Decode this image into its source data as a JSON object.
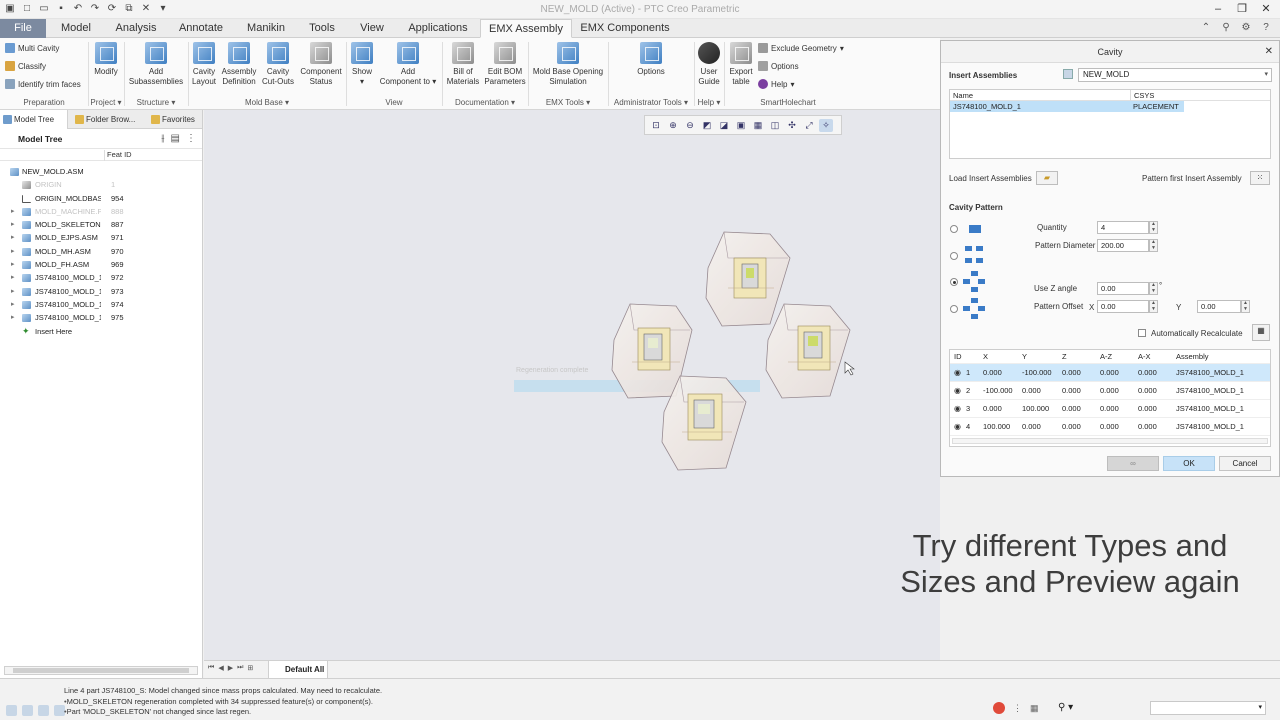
{
  "window": {
    "title": "NEW_MOLD (Active) - PTC Creo Parametric"
  },
  "tabs": [
    "File",
    "Model",
    "Analysis",
    "Annotate",
    "Manikin",
    "Tools",
    "View",
    "Applications",
    "EMX Assembly",
    "EMX Components"
  ],
  "active_tab": "EMX Assembly",
  "ribbon": {
    "prep_items": [
      "Multi Cavity",
      "Classify",
      "Identify trim faces"
    ],
    "modify": "Modify",
    "add_subassemblies": [
      "Add",
      "Subassemblies"
    ],
    "cavity_layout": [
      "Cavity",
      "Layout"
    ],
    "assembly_definition": [
      "Assembly",
      "Definition"
    ],
    "cavity_cutouts": [
      "Cavity",
      "Cut-Outs"
    ],
    "component_status": [
      "Component",
      "Status"
    ],
    "show": "Show",
    "add_component": [
      "Add",
      "Component to"
    ],
    "bill_of_materials": [
      "Bill of",
      "Materials"
    ],
    "edit_bom": [
      "Edit BOM",
      "Parameters"
    ],
    "mold_base_sim": [
      "Mold Base Opening",
      "Simulation"
    ],
    "options_big": "Options",
    "user_guide": [
      "User",
      "Guide"
    ],
    "export_table": [
      "Export",
      "table"
    ],
    "exclude_geometry": "Exclude Geometry",
    "options_small": "Options",
    "help_small": "Help",
    "groups": [
      "Preparation",
      "Project",
      "Structure",
      "Mold Base",
      "View",
      "Documentation",
      "EMX Tools",
      "Administrator Tools",
      "Help",
      "SmartHolechart"
    ]
  },
  "left_panel": {
    "tabs": [
      "Model Tree",
      "Folder Brow...",
      "Favorites"
    ],
    "title": "Model Tree",
    "col_feat": "Feat ID",
    "root": "NEW_MOLD.ASM",
    "rows": [
      {
        "name": "ORIGIN",
        "id": "1",
        "dim": true,
        "icon": "sk"
      },
      {
        "name": "ORIGIN_MOLDBASE",
        "id": "954",
        "dim": false,
        "icon": "csys"
      },
      {
        "name": "MOLD_MACHINE.PI",
        "id": "888",
        "dim": true,
        "icon": "asm"
      },
      {
        "name": "MOLD_SKELETON.PI",
        "id": "887",
        "dim": false,
        "icon": "asm"
      },
      {
        "name": "MOLD_EJPS.ASM",
        "id": "971",
        "dim": false,
        "icon": "asm"
      },
      {
        "name": "MOLD_MH.ASM",
        "id": "970",
        "dim": false,
        "icon": "asm"
      },
      {
        "name": "MOLD_FH.ASM",
        "id": "969",
        "dim": false,
        "icon": "asm"
      },
      {
        "name": "JS748100_MOLD_1...",
        "id": "972",
        "dim": false,
        "icon": "asm"
      },
      {
        "name": "JS748100_MOLD_1...",
        "id": "973",
        "dim": false,
        "icon": "asm"
      },
      {
        "name": "JS748100_MOLD_1...",
        "id": "974",
        "dim": false,
        "icon": "asm"
      },
      {
        "name": "JS748100_MOLD_1...",
        "id": "975",
        "dim": false,
        "icon": "asm"
      },
      {
        "name": "Insert Here",
        "id": "",
        "dim": false,
        "icon": "ins"
      }
    ]
  },
  "graphics": {
    "ghost_text": "Regeneration complete",
    "caption_line1": "Try different Types and",
    "caption_line2": "Sizes and Preview again"
  },
  "bottom_tab": "Default All",
  "dialog": {
    "title": "Cavity",
    "insert_assemblies_label": "Insert Assemblies",
    "insert_assembly_value": "NEW_MOLD",
    "table_headers": [
      "Name",
      "CSYS"
    ],
    "table_row": [
      "JS748100_MOLD_1",
      "PLACEMENT"
    ],
    "load_insert_label": "Load Insert Assemblies",
    "pattern_first_label": "Pattern first Insert Assembly",
    "cavity_pattern_label": "Cavity Pattern",
    "quantity_label": "Quantity",
    "quantity_value": "4",
    "pattern_diameter_label": "Pattern Diameter",
    "pattern_diameter_value": "200.00",
    "use_z_angle_label": "Use Z angle",
    "use_z_angle_value": "0.00",
    "pattern_offset_label": "Pattern Offset",
    "x_label": "X",
    "offset_x_value": "0.00",
    "y_label": "Y",
    "offset_y_value": "0.00",
    "auto_recalc_label": "Automatically Recalculate",
    "pattern_headers": [
      "ID",
      "X",
      "Y",
      "Z",
      "A-Z",
      "A-X",
      "Assembly"
    ],
    "pattern_rows": [
      [
        "1",
        "0.000",
        "-100.000",
        "0.000",
        "0.000",
        "0.000",
        "JS748100_MOLD_1"
      ],
      [
        "2",
        "-100.000",
        "0.000",
        "0.000",
        "0.000",
        "0.000",
        "JS748100_MOLD_1"
      ],
      [
        "3",
        "0.000",
        "100.000",
        "0.000",
        "0.000",
        "0.000",
        "JS748100_MOLD_1"
      ],
      [
        "4",
        "100.000",
        "0.000",
        "0.000",
        "0.000",
        "0.000",
        "JS748100_MOLD_1"
      ]
    ],
    "ok": "OK",
    "cancel": "Cancel"
  },
  "status": {
    "messages": [
      "Line 4 part JS748100_S: Model changed since mass props calculated. May need to recalculate.",
      "MOLD_SKELETON regeneration completed with 34 suppressed feature(s) or component(s).",
      "Part 'MOLD_SKELETON' not changed since last regen."
    ]
  },
  "colors": {
    "accent": "#3f7fc2",
    "file_tab": "#7c8aa0",
    "selection": "#bfe0f8",
    "ok_button": "#c7e2f8"
  }
}
